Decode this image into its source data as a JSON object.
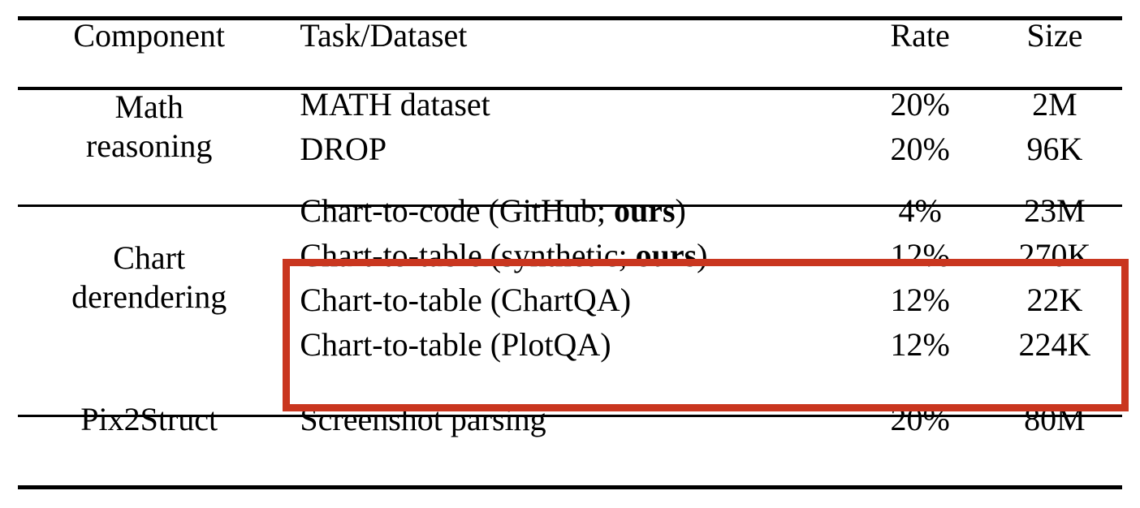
{
  "table": {
    "caption_present": false,
    "columns": [
      {
        "key": "component",
        "label": "Component",
        "align": "center"
      },
      {
        "key": "task",
        "label": "Task/Dataset",
        "align": "left"
      },
      {
        "key": "rate",
        "label": "Rate",
        "align": "center"
      },
      {
        "key": "size",
        "label": "Size",
        "align": "center"
      }
    ],
    "groups": [
      {
        "id": "math-reasoning",
        "component_line1": "Math",
        "component_line2": "reasoning",
        "rows": [
          {
            "task_prefix": "MATH dataset",
            "task_bold": "",
            "task_suffix": "",
            "rate": "20%",
            "size": "2M",
            "highlighted": false
          },
          {
            "task_prefix": "DROP",
            "task_bold": "",
            "task_suffix": "",
            "rate": "20%",
            "size": "96K",
            "highlighted": false
          }
        ]
      },
      {
        "id": "chart-derendering",
        "component_line1": "Chart",
        "component_line2": "derendering",
        "rows": [
          {
            "task_prefix": "Chart-to-code (GitHub; ",
            "task_bold": "ours",
            "task_suffix": ")",
            "rate": "4%",
            "size": "23M",
            "highlighted": false
          },
          {
            "task_prefix": "Chart-to-table (synthetic; ",
            "task_bold": "ours",
            "task_suffix": ")",
            "rate": "12%",
            "size": "270K",
            "highlighted": true
          },
          {
            "task_prefix": "Chart-to-table (ChartQA)",
            "task_bold": "",
            "task_suffix": "",
            "rate": "12%",
            "size": "22K",
            "highlighted": true
          },
          {
            "task_prefix": "Chart-to-table (PlotQA)",
            "task_bold": "",
            "task_suffix": "",
            "rate": "12%",
            "size": "224K",
            "highlighted": true
          }
        ]
      },
      {
        "id": "pix2struct",
        "component_line1": "Pix2Struct",
        "component_line2": "",
        "rows": [
          {
            "task_prefix": "Screenshot parsing",
            "task_bold": "",
            "task_suffix": "",
            "rate": "20%",
            "size": "80M",
            "highlighted": false
          }
        ]
      }
    ]
  },
  "annotation": {
    "highlight_color": "#c9361f",
    "highlight_label": "chart-to-table-rows-highlight",
    "rule_color": "#000000",
    "background_color": "#ffffff"
  }
}
